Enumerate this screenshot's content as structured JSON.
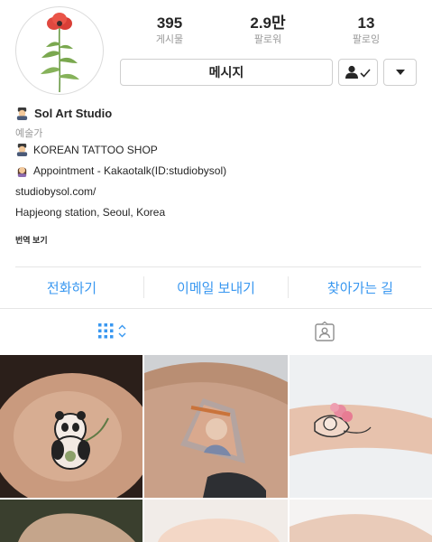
{
  "stats": {
    "posts": {
      "value": "395",
      "label": "게시물"
    },
    "followers": {
      "value": "2.9만",
      "label": "팔로워"
    },
    "following": {
      "value": "13",
      "label": "팔로잉"
    }
  },
  "buttons": {
    "message": "메시지",
    "following_icon": "person-check-icon",
    "more_icon": "triangle-down-icon"
  },
  "profile": {
    "name": "Sol Art Studio",
    "category": "예술가",
    "bio_lines": [
      "KOREAN TATTOO SHOP",
      "Appointment - Kakaotalk(ID:studiobysol)",
      "studiobysol.com/",
      "Hapjeong station, Seoul, Korea"
    ],
    "translate": "번역 보기"
  },
  "actions": [
    "전화하기",
    "이메일 보내기",
    "찾아가는 길"
  ],
  "tabs": {
    "grid_icon": "grid-icon",
    "tagged_icon": "tagged-photo-icon"
  },
  "colors": {
    "accent": "#3897f0",
    "text": "#262626",
    "muted": "#999999"
  }
}
